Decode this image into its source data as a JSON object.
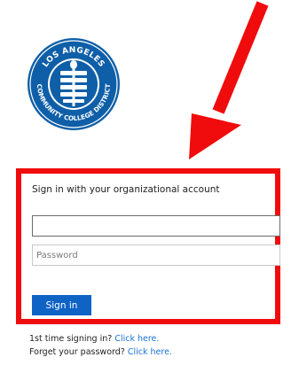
{
  "logo": {
    "top_text": "LOS ANGELES",
    "bottom_text": "COMMUNITY COLLEGE DISTRICT",
    "color": "#0f5fa8"
  },
  "annotation": {
    "arrow_color": "#f00c0c",
    "box_color": "#f00c0c"
  },
  "form": {
    "heading": "Sign in with your organizational account",
    "username_value": "",
    "password_placeholder": "Password",
    "signin_label": "Sign in"
  },
  "help": {
    "first_time_text": "1st time signing in?",
    "first_time_link": "Click here.",
    "forgot_text": "Forget your password?",
    "forgot_link": "Click here."
  }
}
